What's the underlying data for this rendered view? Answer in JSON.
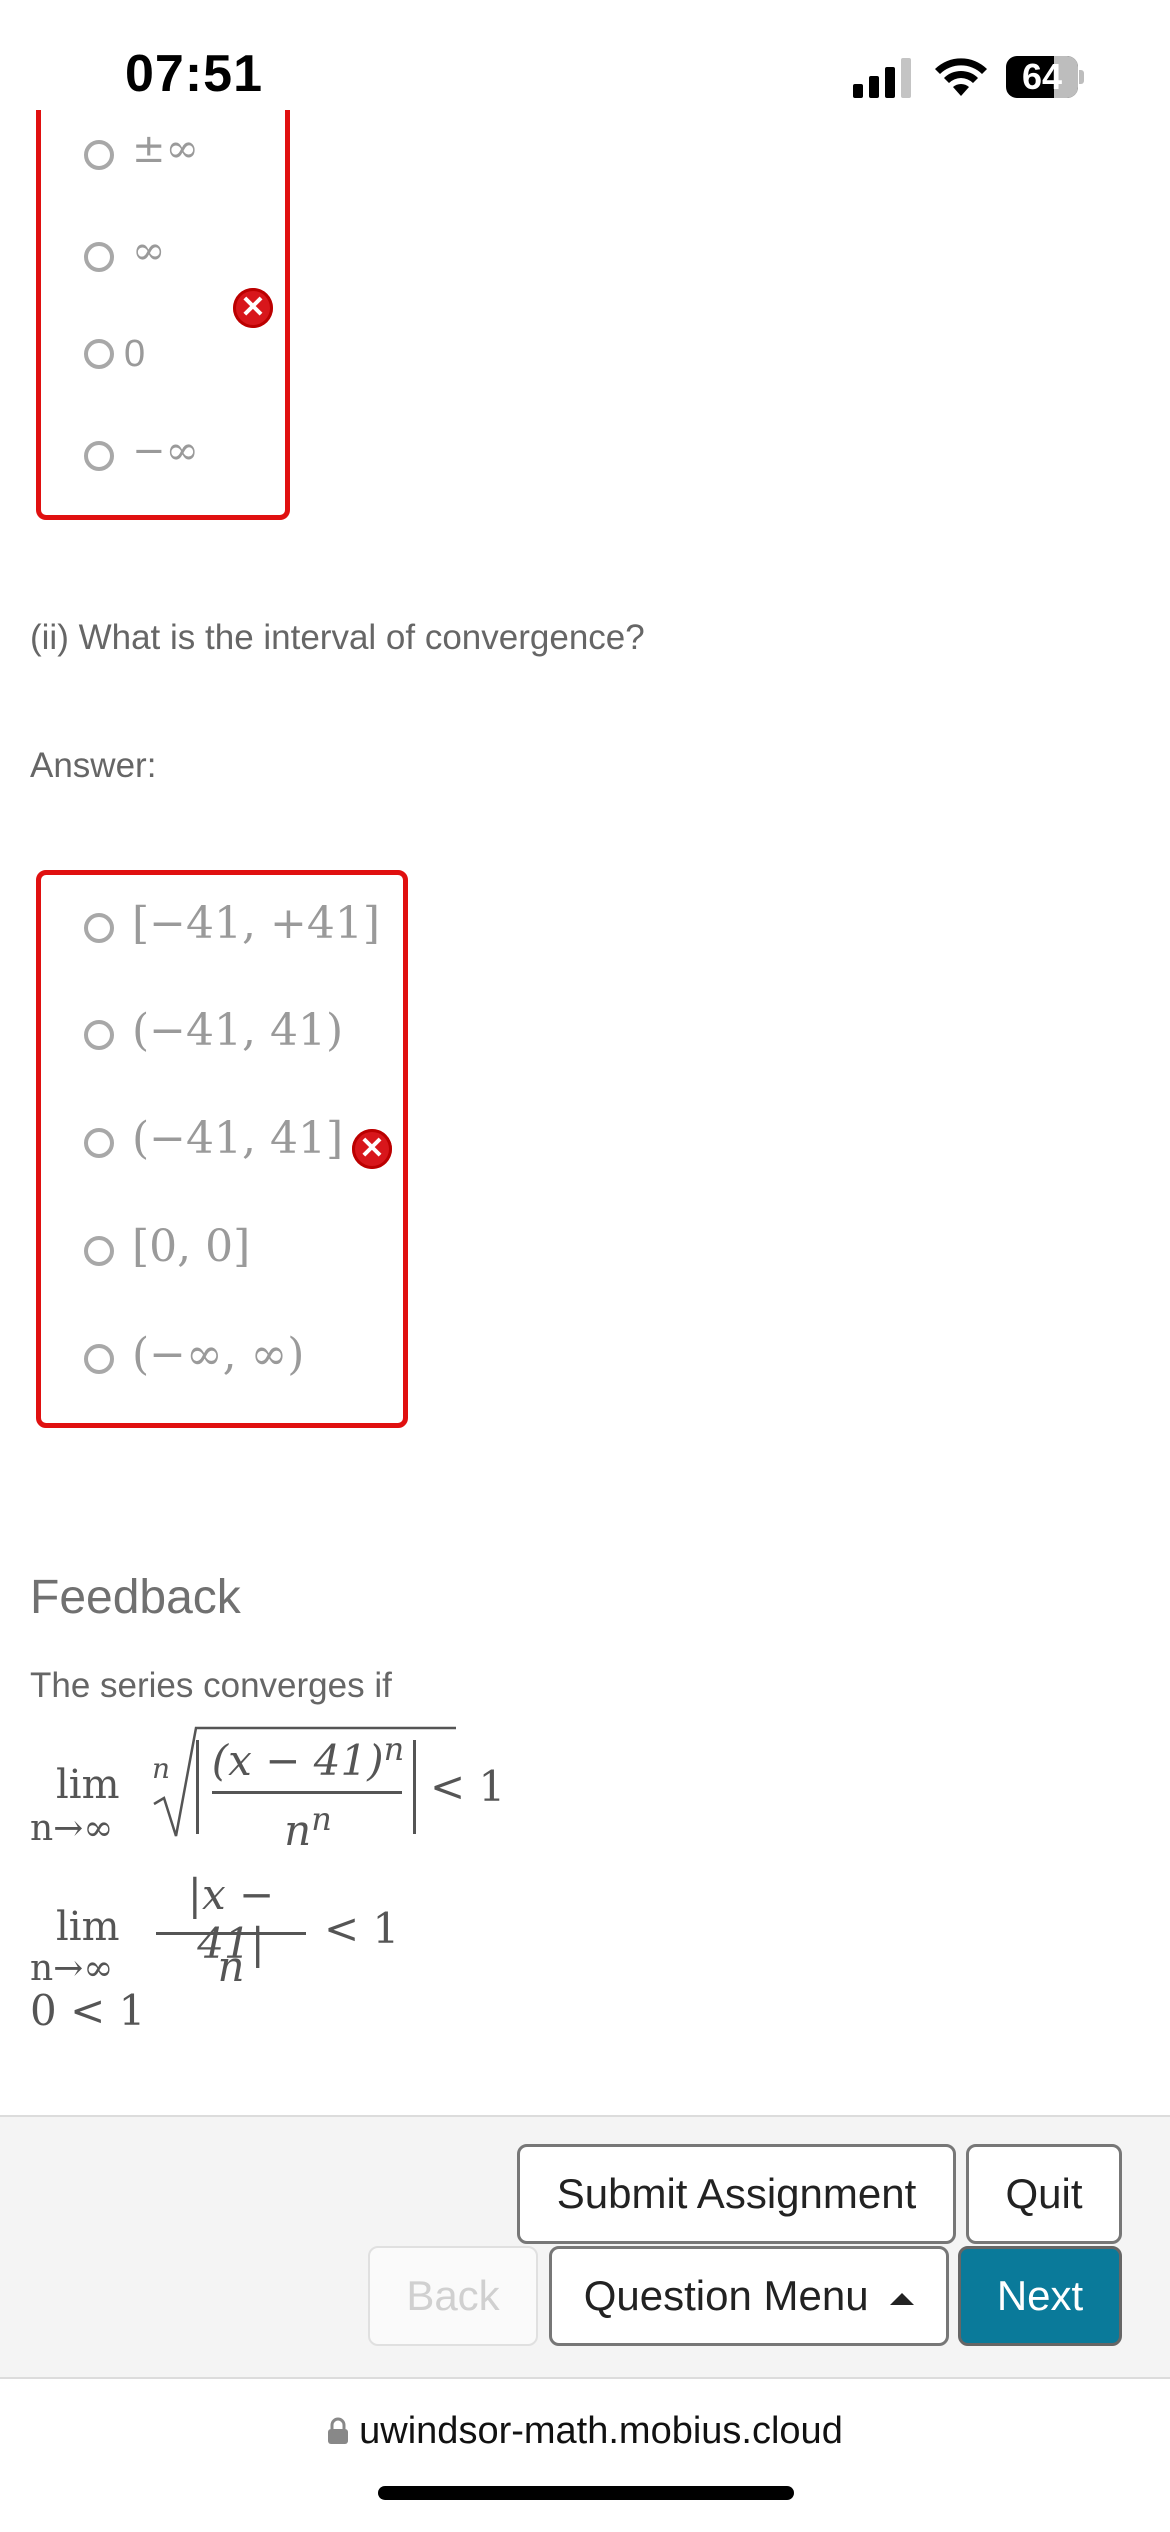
{
  "status_bar": {
    "time": "07:51",
    "battery": "64"
  },
  "question1": {
    "options": [
      "±∞",
      "∞",
      "0",
      "−∞"
    ],
    "result_icon": "x-circle-icon"
  },
  "question2": {
    "prompt": "(ii) What is the interval of convergence?",
    "answer_label": "Answer:",
    "options": [
      "[−41, +41]",
      "(−41, 41)",
      "(−41, 41]",
      "[0, 0]",
      "(−∞, ∞)"
    ],
    "result_icon": "x-circle-icon"
  },
  "feedback": {
    "title": "Feedback",
    "intro": "The series converges if",
    "lim": "lim",
    "lim_sub": "n→∞",
    "root_index": "n",
    "frac1_num": "(x − 41)",
    "frac1_num_exp": "n",
    "frac1_den": "n",
    "frac1_den_exp": "n",
    "lt_one": "< 1",
    "frac2_num": "|x − 41|",
    "frac2_den": "n",
    "final": "0 < 1"
  },
  "footer": {
    "submit": "Submit Assignment",
    "quit": "Quit",
    "back": "Back",
    "question_menu": "Question Menu",
    "next": "Next"
  },
  "browser": {
    "url": "uwindsor-math.mobius.cloud"
  }
}
